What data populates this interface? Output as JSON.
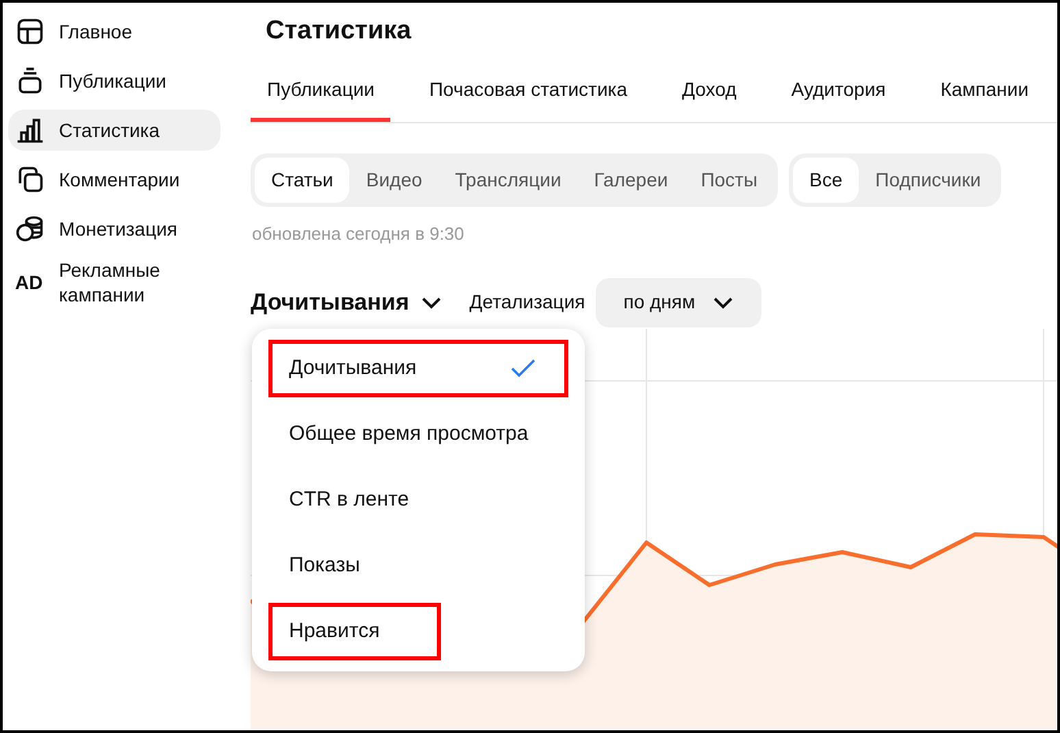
{
  "sidebar": {
    "items": [
      {
        "label": "Главное",
        "selected": false
      },
      {
        "label": "Публикации",
        "selected": false
      },
      {
        "label": "Статистика",
        "selected": true
      },
      {
        "label": "Комментарии",
        "selected": false
      },
      {
        "label": "Монетизация",
        "selected": false
      },
      {
        "label": "Рекламные кампании",
        "icon_text": "AD",
        "selected": false
      }
    ]
  },
  "page_title": "Статистика",
  "tabs": [
    {
      "label": "Публикации",
      "selected": true
    },
    {
      "label": "Почасовая статистика",
      "selected": false
    },
    {
      "label": "Доход",
      "selected": false
    },
    {
      "label": "Аудитория",
      "selected": false
    },
    {
      "label": "Кампании",
      "selected": false
    }
  ],
  "content_filter": [
    {
      "label": "Статьи",
      "selected": true
    },
    {
      "label": "Видео",
      "selected": false
    },
    {
      "label": "Трансляции",
      "selected": false
    },
    {
      "label": "Галереи",
      "selected": false
    },
    {
      "label": "Посты",
      "selected": false
    }
  ],
  "audience_filter": [
    {
      "label": "Все",
      "selected": true
    },
    {
      "label": "Подписчики",
      "selected": false
    }
  ],
  "updated": "обновлена сегодня в 9:30",
  "metric": {
    "label": "Дочитывания",
    "expanded": true
  },
  "detail": {
    "label": "Детализация",
    "value": "по дням"
  },
  "metric_menu": [
    {
      "label": "Дочитывания",
      "selected": true,
      "highlighted": true
    },
    {
      "label": "Общее время просмотра",
      "selected": false,
      "highlighted": false
    },
    {
      "label": "CTR в ленте",
      "selected": false,
      "highlighted": false
    },
    {
      "label": "Показы",
      "selected": false,
      "highlighted": false
    },
    {
      "label": "Нравится",
      "selected": false,
      "highlighted": true
    }
  ]
}
